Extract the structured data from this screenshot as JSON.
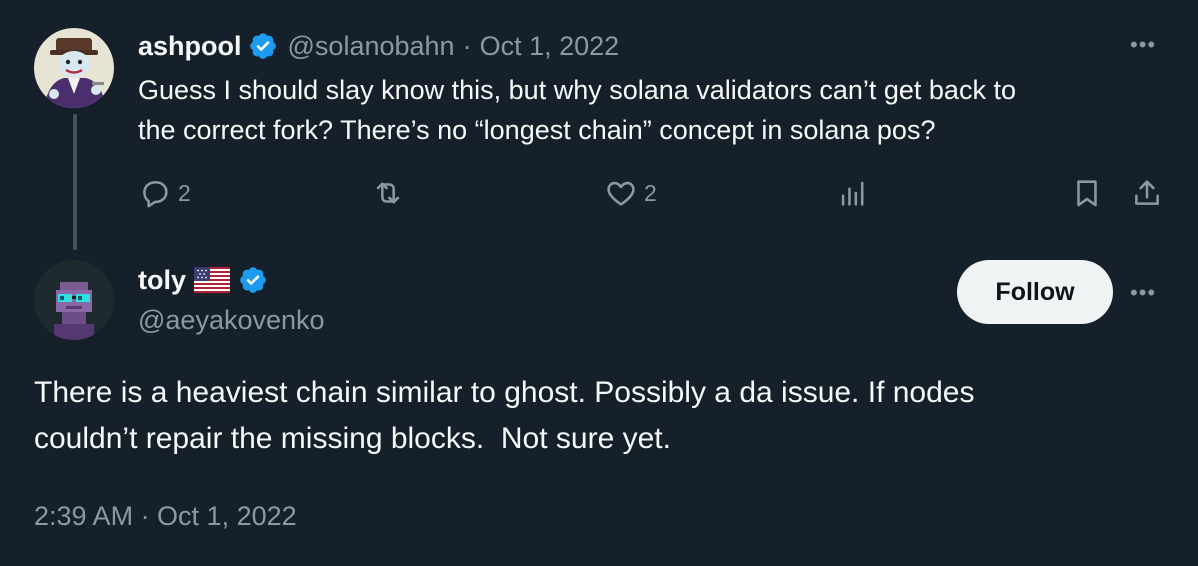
{
  "parent_tweet": {
    "display_name": "ashpool",
    "handle": "@solanobahn",
    "separator": "·",
    "date": "Oct 1, 2022",
    "text_line1": "Guess I should slay know this, but why solana validators can’t get back to",
    "text_line2": "the correct fork? There’s no “longest chain” concept in solana pos?",
    "reply_count": "2",
    "like_count": "2",
    "more_label": "•••"
  },
  "main_tweet": {
    "display_name": "toly",
    "handle": "@aeyakovenko",
    "follow_label": "Follow",
    "more_label": "•••",
    "text_line1": "There is a heaviest chain similar to ghost. Possibly a da issue. If nodes",
    "text_line2": "couldn’t repair the missing blocks.  Not sure yet.",
    "timestamp": "2:39 AM · Oct 1, 2022"
  },
  "colors": {
    "background": "#15202b",
    "text": "#f7f9f9",
    "muted": "#8b98a5",
    "verified": "#1d9bf0",
    "thread_line": "#425364",
    "follow_bg": "#eff3f4"
  },
  "icons": {
    "verified": "verified-badge-icon",
    "reply": "reply-icon",
    "retweet": "retweet-icon",
    "like": "heart-icon",
    "views": "views-icon",
    "bookmark": "bookmark-icon",
    "share": "share-icon",
    "flag": "us-flag-icon"
  }
}
